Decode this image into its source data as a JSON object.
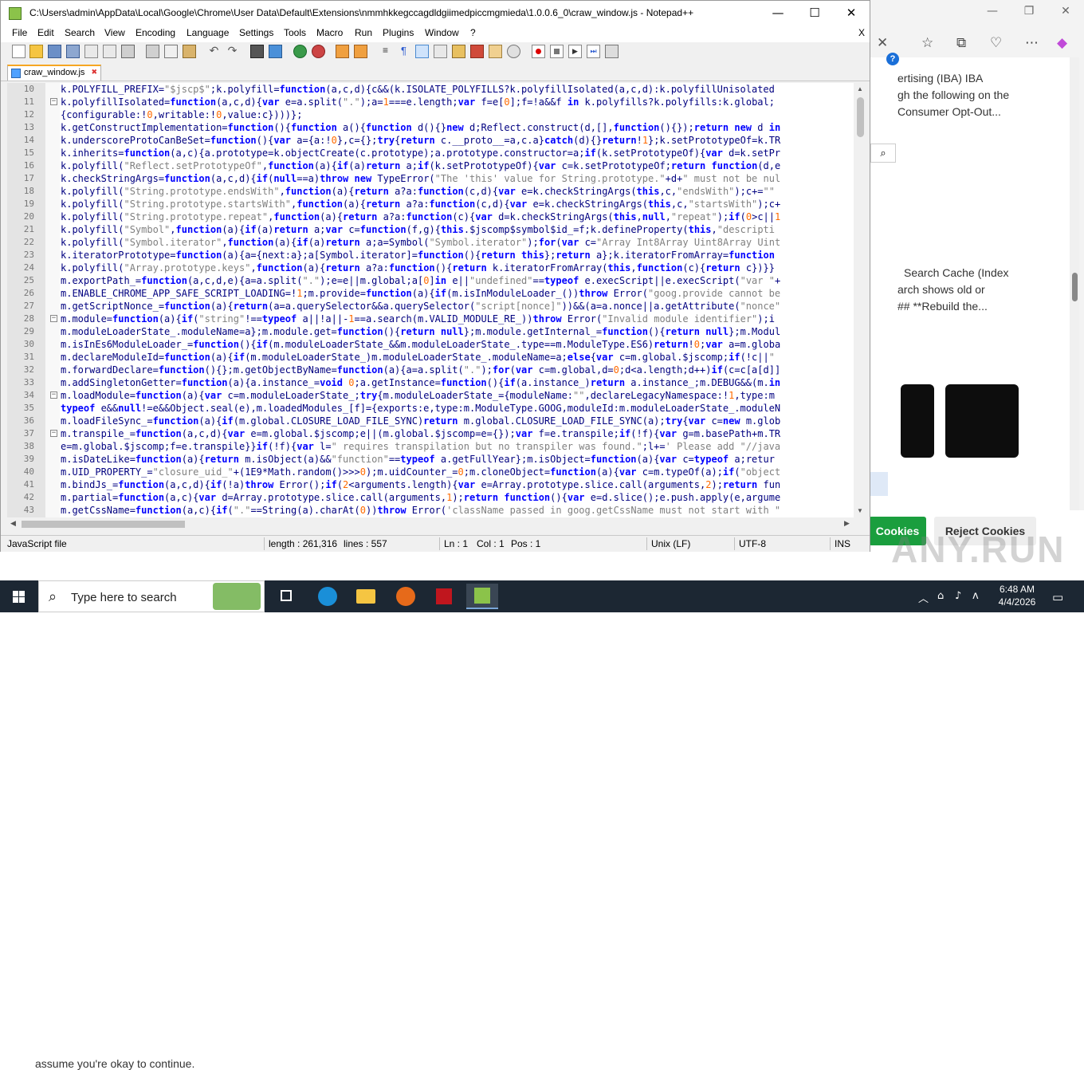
{
  "browser": {
    "text_lines": [
      "ertising (IBA) IBA",
      "gh the following on the",
      "Consumer Opt-Out..."
    ],
    "text_lines2": [
      "Search Cache (Index",
      "arch shows old or",
      "## **Rebuild the..."
    ],
    "cookie_behind": "assume you're okay to continue.",
    "accept_label": "Cookies",
    "reject_label": "Reject Cookies",
    "watermark": "ANY.RUN"
  },
  "npp": {
    "title": "C:\\Users\\admin\\AppData\\Local\\Google\\Chrome\\User Data\\Default\\Extensions\\nmmhkkegccagdldgiimedpiccmgmieda\\1.0.0.6_0\\craw_window.js - Notepad++",
    "menu": [
      "File",
      "Edit",
      "Search",
      "View",
      "Encoding",
      "Language",
      "Settings",
      "Tools",
      "Macro",
      "Run",
      "Plugins",
      "Window",
      "?"
    ],
    "menu_close": "X",
    "tab": "craw_window.js",
    "lines": [
      {
        "n": "10",
        "fold": "",
        "code": "k.POLYFILL_PREFIX=\"$jscp$\";k.polyfill=function(a,c,d){c&&(k.ISOLATE_POLYFILLS?k.polyfillIsolated(a,c,d):k.polyfillUnisolated"
      },
      {
        "n": "11",
        "fold": "−",
        "code": "k.polyfillIsolated=function(a,c,d){var e=a.split(\".\");a=1===e.length;var f=e[0];f=!a&&f in k.polyfills?k.polyfills:k.global;"
      },
      {
        "n": "12",
        "fold": "",
        "code": "{configurable:!0,writable:!0,value:c})))};"
      },
      {
        "n": "13",
        "fold": "",
        "code": "k.getConstructImplementation=function(){function a(){function d(){}new d;Reflect.construct(d,[],function(){});return new d in"
      },
      {
        "n": "14",
        "fold": "",
        "code": "k.underscoreProtoCanBeSet=function(){var a={a:!0},c={};try{return c.__proto__=a,c.a}catch(d){}return!1};k.setPrototypeOf=k.TR"
      },
      {
        "n": "15",
        "fold": "",
        "code": "k.inherits=function(a,c){a.prototype=k.objectCreate(c.prototype);a.prototype.constructor=a;if(k.setPrototypeOf){var d=k.setPr"
      },
      {
        "n": "16",
        "fold": "",
        "code": "k.polyfill(\"Reflect.setPrototypeOf\",function(a){if(a)return a;if(k.setPrototypeOf){var c=k.setPrototypeOf;return function(d,e"
      },
      {
        "n": "17",
        "fold": "",
        "code": "k.checkStringArgs=function(a,c,d){if(null==a)throw new TypeError(\"The 'this' value for String.prototype.\"+d+\" must not be nul"
      },
      {
        "n": "18",
        "fold": "",
        "code": "k.polyfill(\"String.prototype.endsWith\",function(a){return a?a:function(c,d){var e=k.checkStringArgs(this,c,\"endsWith\");c+=\"\""
      },
      {
        "n": "19",
        "fold": "",
        "code": "k.polyfill(\"String.prototype.startsWith\",function(a){return a?a:function(c,d){var e=k.checkStringArgs(this,c,\"startsWith\");c+"
      },
      {
        "n": "20",
        "fold": "",
        "code": "k.polyfill(\"String.prototype.repeat\",function(a){return a?a:function(c){var d=k.checkStringArgs(this,null,\"repeat\");if(0>c||1"
      },
      {
        "n": "21",
        "fold": "",
        "code": "k.polyfill(\"Symbol\",function(a){if(a)return a;var c=function(f,g){this.$jscomp$symbol$id_=f;k.defineProperty(this,\"descripti"
      },
      {
        "n": "22",
        "fold": "",
        "code": "k.polyfill(\"Symbol.iterator\",function(a){if(a)return a;a=Symbol(\"Symbol.iterator\");for(var c=\"Array Int8Array Uint8Array Uint"
      },
      {
        "n": "23",
        "fold": "",
        "code": "k.iteratorPrototype=function(a){a={next:a};a[Symbol.iterator]=function(){return this};return a};k.iteratorFromArray=function"
      },
      {
        "n": "24",
        "fold": "",
        "code": "k.polyfill(\"Array.prototype.keys\",function(a){return a?a:function(){return k.iteratorFromArray(this,function(c){return c})}}"
      },
      {
        "n": "25",
        "fold": "",
        "code": "m.exportPath_=function(a,c,d,e){a=a.split(\".\");e=e||m.global;a[0]in e||\"undefined\"==typeof e.execScript||e.execScript(\"var \"+"
      },
      {
        "n": "26",
        "fold": "",
        "code": "m.ENABLE_CHROME_APP_SAFE_SCRIPT_LOADING=!1;m.provide=function(a){if(m.isInModuleLoader_())throw Error(\"goog.provide cannot be"
      },
      {
        "n": "27",
        "fold": "",
        "code": "m.getScriptNonce_=function(a){return(a=a.querySelector&&a.querySelector(\"script[nonce]\"))&&(a=a.nonce||a.getAttribute(\"nonce\""
      },
      {
        "n": "28",
        "fold": "−",
        "code": "m.module=function(a){if(\"string\"!==typeof a||!a||-1==a.search(m.VALID_MODULE_RE_))throw Error(\"Invalid module identifier\");i"
      },
      {
        "n": "29",
        "fold": "",
        "code": "m.moduleLoaderState_.moduleName=a};m.module.get=function(){return null};m.module.getInternal_=function(){return null};m.Modul"
      },
      {
        "n": "30",
        "fold": "",
        "code": "m.isInEs6ModuleLoader_=function(){if(m.moduleLoaderState_&&m.moduleLoaderState_.type==m.ModuleType.ES6)return!0;var a=m.globa"
      },
      {
        "n": "31",
        "fold": "",
        "code": "m.declareModuleId=function(a){if(m.moduleLoaderState_)m.moduleLoaderState_.moduleName=a;else{var c=m.global.$jscomp;if(!c||\""
      },
      {
        "n": "32",
        "fold": "",
        "code": "m.forwardDeclare=function(){};m.getObjectByName=function(a){a=a.split(\".\");for(var c=m.global,d=0;d<a.length;d++)if(c=c[a[d]]"
      },
      {
        "n": "33",
        "fold": "",
        "code": "m.addSingletonGetter=function(a){a.instance_=void 0;a.getInstance=function(){if(a.instance_)return a.instance_;m.DEBUG&&(m.in"
      },
      {
        "n": "34",
        "fold": "−",
        "code": "m.loadModule=function(a){var c=m.moduleLoaderState_;try{m.moduleLoaderState_={moduleName:\"\",declareLegacyNamespace:!1,type:m"
      },
      {
        "n": "35",
        "fold": "",
        "code": "typeof e&&null!=e&&Object.seal(e),m.loadedModules_[f]={exports:e,type:m.ModuleType.GOOG,moduleId:m.moduleLoaderState_.moduleN"
      },
      {
        "n": "36",
        "fold": "",
        "code": "m.loadFileSync_=function(a){if(m.global.CLOSURE_LOAD_FILE_SYNC)return m.global.CLOSURE_LOAD_FILE_SYNC(a);try{var c=new m.glob"
      },
      {
        "n": "37",
        "fold": "−",
        "code": "m.transpile_=function(a,c,d){var e=m.global.$jscomp;e||(m.global.$jscomp=e={});var f=e.transpile;if(!f){var g=m.basePath+m.TR"
      },
      {
        "n": "38",
        "fold": "",
        "code": "e=m.global.$jscomp;f=e.transpile}}if(!f){var l=\" requires transpilation but no transpiler was found.\";l+=' Please add \"//java"
      },
      {
        "n": "39",
        "fold": "",
        "code": "m.isDateLike=function(a){return m.isObject(a)&&\"function\"==typeof a.getFullYear};m.isObject=function(a){var c=typeof a;retur"
      },
      {
        "n": "40",
        "fold": "",
        "code": "m.UID_PROPERTY_=\"closure_uid_\"+(1E9*Math.random()>>>0);m.uidCounter_=0;m.cloneObject=function(a){var c=m.typeOf(a);if(\"object"
      },
      {
        "n": "41",
        "fold": "",
        "code": "m.bindJs_=function(a,c,d){if(!a)throw Error();if(2<arguments.length){var e=Array.prototype.slice.call(arguments,2);return fun"
      },
      {
        "n": "42",
        "fold": "",
        "code": "m.partial=function(a,c){var d=Array.prototype.slice.call(arguments,1);return function(){var e=d.slice();e.push.apply(e,argume"
      },
      {
        "n": "43",
        "fold": "",
        "code": "m.getCssName=function(a,c){if(\".\"==String(a).charAt(0))throw Error('className passed in goog.getCssName must not start with \""
      }
    ],
    "status": {
      "lang": "JavaScript file",
      "length": "length : 261,316",
      "lines": "lines : 557",
      "ln": "Ln : 1",
      "col": "Col : 1",
      "pos": "Pos : 1",
      "eol": "Unix (LF)",
      "enc": "UTF-8",
      "ins": "INS"
    }
  },
  "taskbar": {
    "search_placeholder": "Type here to search",
    "time": "6:48 AM",
    "date": "4/4/2026"
  },
  "colors": {
    "keyword": "#0000ff",
    "string": "#808080",
    "text": "#000080",
    "accept": "#1a9e3e",
    "taskbar": "#1c2733"
  }
}
